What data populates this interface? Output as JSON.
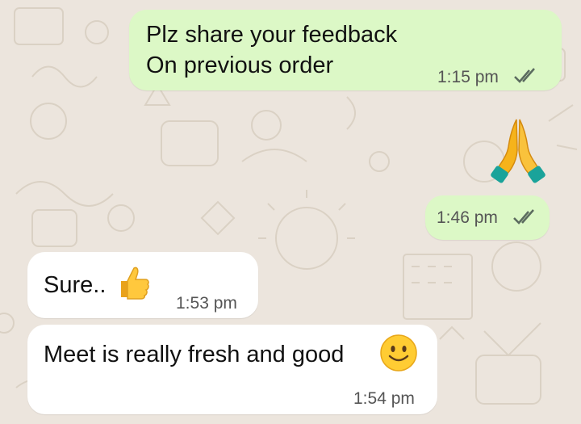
{
  "chat": {
    "messages": [
      {
        "direction": "outgoing",
        "lines": [
          "Plz share your feedback",
          "On previous order"
        ],
        "time": "1:15 pm",
        "status": "read-double-tick"
      },
      {
        "direction": "outgoing",
        "emoji": "folded-hands-icon",
        "time": "1:46 pm",
        "status": "read-double-tick"
      },
      {
        "direction": "incoming",
        "text": "Sure..",
        "emoji": "thumbs-up-icon",
        "time": "1:53 pm"
      },
      {
        "direction": "incoming",
        "text": "Meet is really fresh and good",
        "emoji": "smiling-face-icon",
        "time": "1:54 pm"
      }
    ]
  },
  "colors": {
    "outgoing_bubble": "#dcf8c6",
    "incoming_bubble": "#ffffff",
    "wallpaper": "#ece5dd",
    "tick_color": "#5b6b5f"
  }
}
